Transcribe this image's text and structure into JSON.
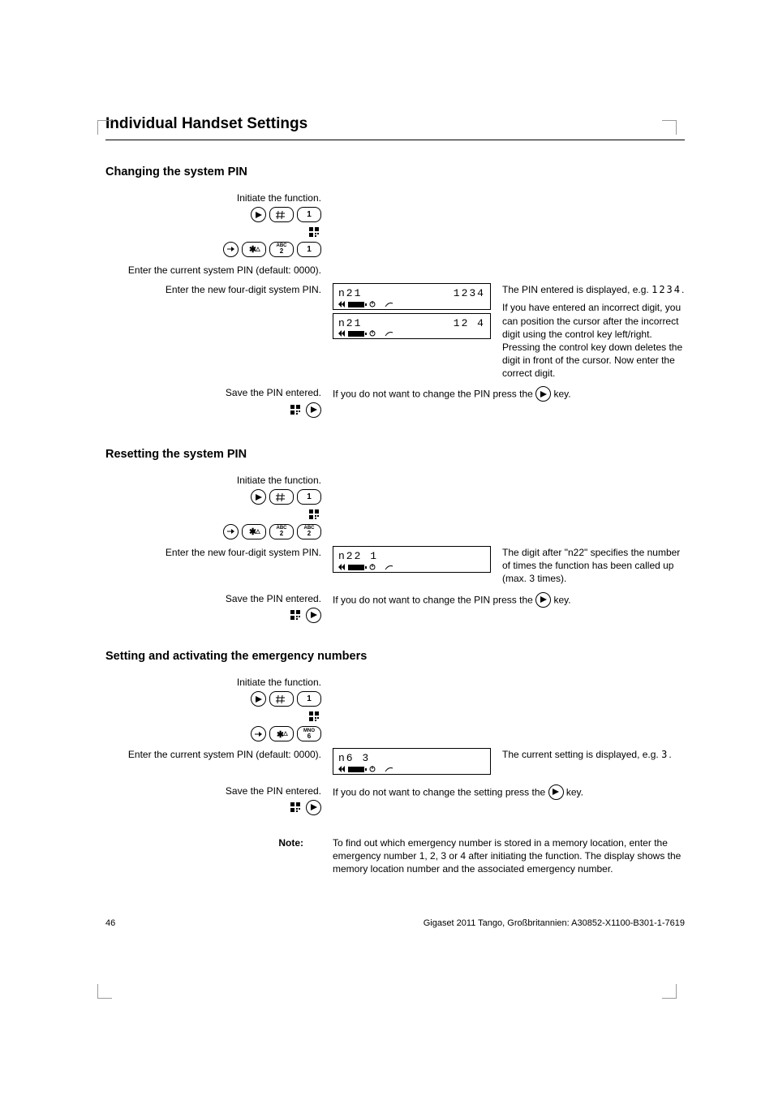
{
  "title": "Individual Handset Settings",
  "sections": [
    {
      "heading": "Changing the system PIN",
      "steps": [
        {
          "left_desc": "Initiate the function.",
          "keys": [
            "play",
            "hash",
            "one",
            "intern",
            "forward",
            "star",
            "two-abc",
            "one"
          ],
          "right": ""
        },
        {
          "left_desc": "Enter the current system PIN (default: 0000).",
          "right": ""
        },
        {
          "left_desc": "Enter the new four-digit system PIN.",
          "lcds": [
            {
              "row1_left": "n21",
              "row1_right": "1234",
              "row2": "icons"
            },
            {
              "row1_left": "n21",
              "row1_right": "12 4",
              "row2": "icons"
            }
          ],
          "right_text_1": "The PIN entered is displayed, e.g. ",
          "right_text_code": "1234",
          "right_text_2": ".",
          "right_text_3": "If you have entered an incorrect digit, you can position the cursor after the incorrect digit using the control key left/right. Pressing the control key down deletes the digit in front of the cursor. Now enter the correct digit."
        },
        {
          "left_desc": "Save the PIN entered.",
          "keys_inline": [
            "intern",
            "play"
          ],
          "right_text": "If you do not want to change the PIN press the       key.",
          "right_insert_icon": "play"
        }
      ]
    },
    {
      "heading": "Resetting the system PIN",
      "steps": [
        {
          "left_desc": "Initiate the function.",
          "keys": [
            "play",
            "hash",
            "one",
            "intern",
            "forward",
            "star",
            "two-abc",
            "two-abc"
          ],
          "right": ""
        },
        {
          "left_desc": "Enter the new four-digit system PIN.",
          "lcds": [
            {
              "row1_left": "n22 1",
              "row1_right": "",
              "row2": "icons"
            }
          ],
          "right_text_1": "The digit after \"n22\" specifies the number of times the function has been called up (max. 3 times)."
        },
        {
          "left_desc": "Save the PIN entered.",
          "keys_inline": [
            "intern",
            "play"
          ],
          "right_text": "If you do not want to change the PIN press the       key.",
          "right_insert_icon": "play"
        }
      ]
    },
    {
      "heading": "Setting and activating the emergency numbers",
      "steps": [
        {
          "left_desc": "Initiate the function.",
          "keys": [
            "play",
            "hash",
            "one",
            "intern",
            "forward",
            "star",
            "six-mno"
          ],
          "right": ""
        },
        {
          "left_desc": "Enter the current system PIN (default: 0000).",
          "lcds": [
            {
              "row1_left": "n6 3",
              "row1_right": "",
              "row2": "icons"
            }
          ],
          "right_text_1": "The current setting is displayed, e.g. ",
          "right_text_code": "3",
          "right_text_2": "."
        },
        {
          "left_desc": "Save the PIN entered.",
          "keys_inline": [
            "intern",
            "play"
          ],
          "right_text": "If you do not want to change the setting press the       key.",
          "right_insert_icon": "play"
        }
      ],
      "note_label": "Note:",
      "note_body": "To find out which emergency number is stored in a memory location, enter the emergency number 1, 2, 3 or 4 after initiating the function. The display shows the memory location number and the associated emergency number."
    }
  ],
  "footer_left": "46",
  "footer_right": "Gigaset 2011 Tango, Großbritannien: A30852-X1100-B301-1-7619"
}
